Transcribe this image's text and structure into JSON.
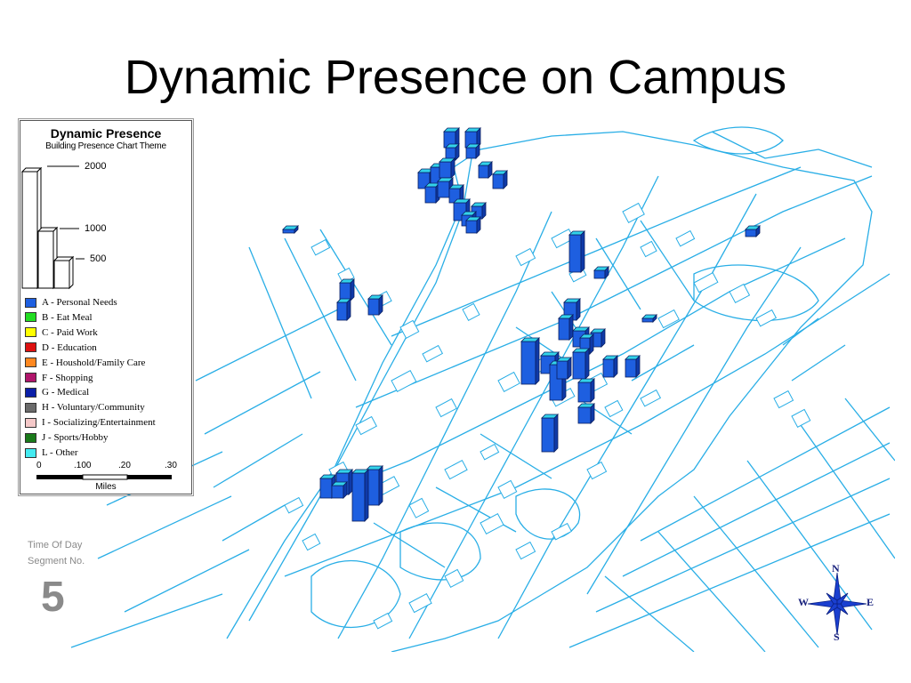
{
  "title": "Dynamic Presence on Campus",
  "legend": {
    "title": "Dynamic Presence",
    "subtitle": "Building Presence Chart Theme",
    "scale_values": [
      "2000",
      "1000",
      "500"
    ],
    "categories": [
      {
        "label": "A - Personal Needs",
        "color": "#1e5fe0"
      },
      {
        "label": "B - Eat Meal",
        "color": "#22dd22"
      },
      {
        "label": "C - Paid Work",
        "color": "#ffff00"
      },
      {
        "label": "D - Education",
        "color": "#dd1111"
      },
      {
        "label": "E - Houshold/Family Care",
        "color": "#ff8820"
      },
      {
        "label": "F - Shopping",
        "color": "#b0156b"
      },
      {
        "label": "G - Medical",
        "color": "#0b1fa8"
      },
      {
        "label": "H - Voluntary/Community",
        "color": "#6a6a6a"
      },
      {
        "label": "I - Socializing/Entertainment",
        "color": "#f4c8c8"
      },
      {
        "label": "J - Sports/Hobby",
        "color": "#1a7a1a"
      },
      {
        "label": "L - Other",
        "color": "#44eaf0"
      }
    ],
    "scale_ticks": [
      "0",
      ".100",
      ".20",
      ".30"
    ],
    "scale_unit": "Miles"
  },
  "time_of_day": {
    "label_line1": "Time Of Day",
    "label_line2": "Segment No.",
    "segment": "5"
  },
  "compass": {
    "n": "N",
    "s": "S",
    "e": "E",
    "w": "W"
  },
  "colors": {
    "road": "#29aee6",
    "bar_front": "#1e5fe0",
    "bar_side": "#0f3aa8",
    "bar_top": "#33d3ea"
  }
}
